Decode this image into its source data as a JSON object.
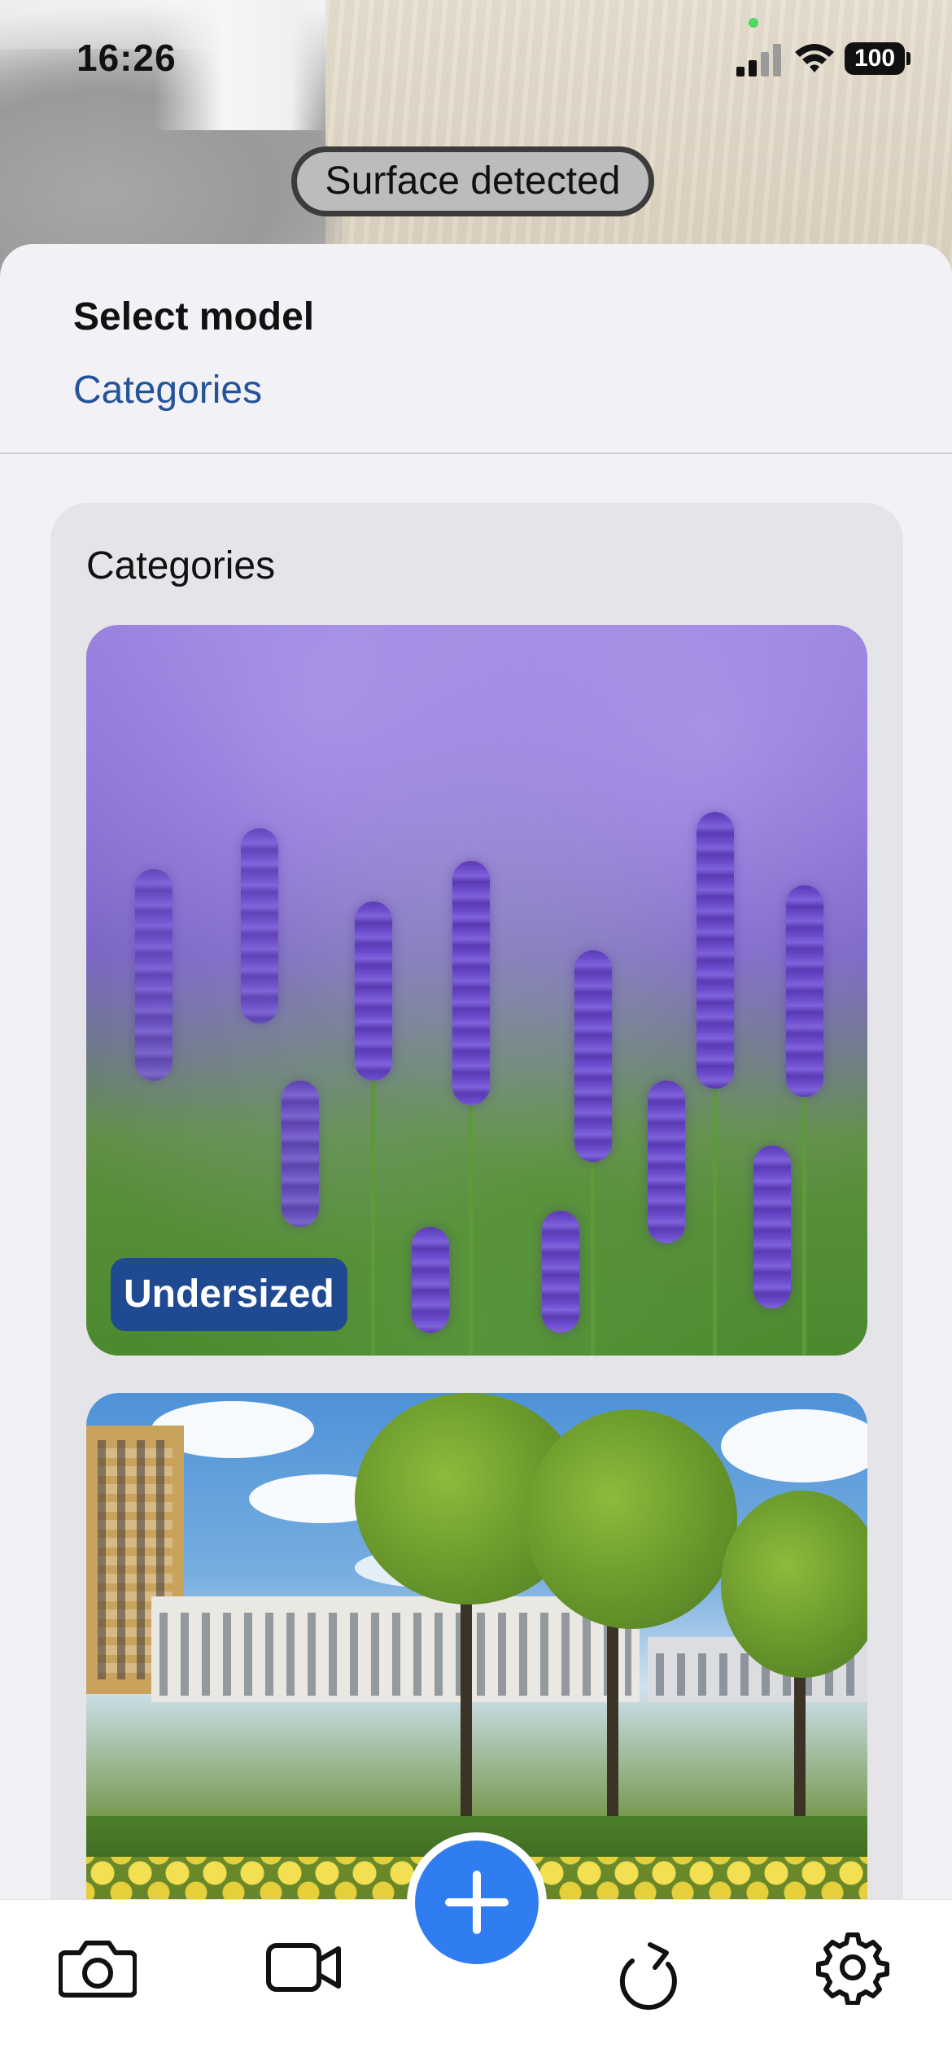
{
  "status_bar": {
    "time": "16:26",
    "battery": "100"
  },
  "ar": {
    "surface_status": "Surface detected"
  },
  "sheet": {
    "title": "Select model",
    "selected_category": "Categories",
    "card": {
      "title": "Categories",
      "items": [
        {
          "badge": "Undersized"
        },
        {
          "badge": ""
        }
      ]
    }
  },
  "tab_bar": {
    "items": [
      {
        "icon": "camera-icon"
      },
      {
        "icon": "video-icon"
      },
      {
        "icon": "plus-icon"
      },
      {
        "icon": "refresh-icon"
      },
      {
        "icon": "gear-icon"
      }
    ]
  },
  "colors": {
    "accent": "#2f7df0",
    "link": "#24539a",
    "badge": "#1f4a92"
  }
}
